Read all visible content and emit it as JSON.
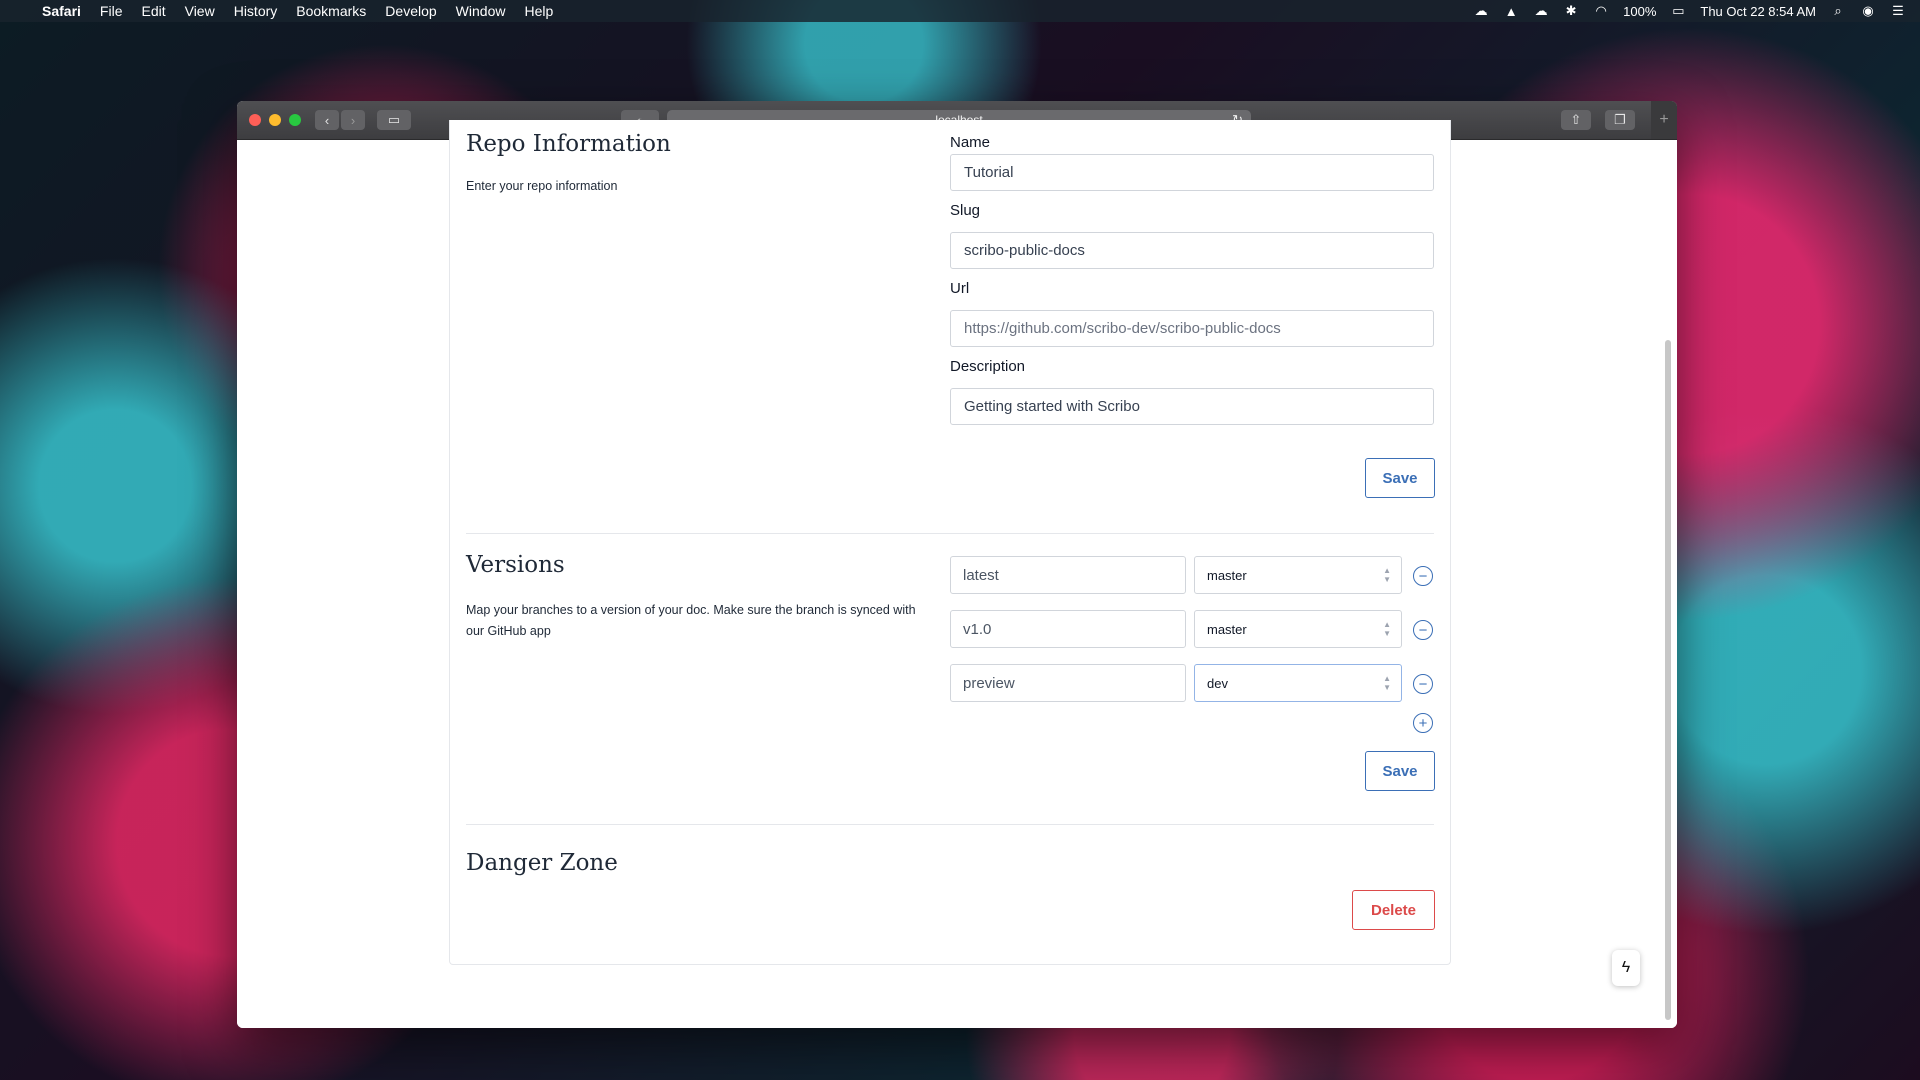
{
  "menubar": {
    "app": "Safari",
    "items": [
      "File",
      "Edit",
      "View",
      "History",
      "Bookmarks",
      "Develop",
      "Window",
      "Help"
    ],
    "battery": "100%",
    "datetime": "Thu Oct 22  8:54 AM"
  },
  "browser": {
    "address": "localhost"
  },
  "repo_info": {
    "title": "Repo Information",
    "description": "Enter your repo information",
    "fields": {
      "name_label": "Name",
      "name_value": "Tutorial",
      "slug_label": "Slug",
      "slug_value": "scribo-public-docs",
      "url_label": "Url",
      "url_value": "https://github.com/scribo-dev/scribo-public-docs",
      "description_label": "Description",
      "description_value": "Getting started with Scribo"
    },
    "save_label": "Save"
  },
  "versions": {
    "title": "Versions",
    "description": "Map your branches to a version of your doc. Make sure the branch is synced with our GitHub app",
    "rows": [
      {
        "name": "latest",
        "branch": "master"
      },
      {
        "name": "v1.0",
        "branch": "master"
      },
      {
        "name": "preview",
        "branch": "dev"
      }
    ],
    "save_label": "Save"
  },
  "danger": {
    "title": "Danger Zone",
    "delete_label": "Delete"
  }
}
